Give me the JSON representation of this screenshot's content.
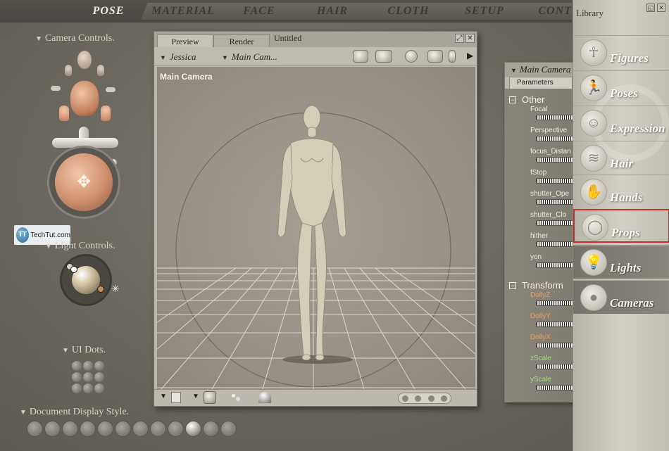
{
  "tabs": [
    "POSE",
    "MATERIAL",
    "FACE",
    "HAIR",
    "CLOTH",
    "SETUP",
    "CONTE"
  ],
  "active_tab": "POSE",
  "left_panel": {
    "camera_controls_label": "Camera Controls.",
    "light_controls_label": "Light Controls.",
    "ui_dots_label": "UI Dots.",
    "document_display_style_label": "Document Display Style.",
    "watermark": {
      "logo_text": "TT",
      "text": "TechTut.com"
    }
  },
  "document": {
    "tabs": [
      "Preview",
      "Render"
    ],
    "active_tab": "Preview",
    "title": "Untitled",
    "figure_select": "Jessica",
    "camera_select": "Main Cam...",
    "viewport_label": "Main Camera"
  },
  "parameters": {
    "header": "Main Camera",
    "tab": "Parameters",
    "groups": [
      {
        "name": "Other",
        "params": [
          "Focal",
          "Perspective",
          "focus_Distan",
          "fStop",
          "shutter_Ope",
          "shutter_Clo",
          "hither",
          "yon"
        ]
      },
      {
        "name": "Transform",
        "params": [
          "DollyZ",
          "DollyY",
          "DollyX",
          "zScale",
          "yScale"
        ]
      }
    ],
    "colors": {
      "default": "#f1ede3",
      "dolly": "#e8a25a",
      "scale": "#9fe07e"
    }
  },
  "library": {
    "title": "Library",
    "items": [
      {
        "label": "Figures",
        "icon": "figure-icon"
      },
      {
        "label": "Poses",
        "icon": "running-figure-icon"
      },
      {
        "label": "Expression",
        "icon": "face-icon"
      },
      {
        "label": "Hair",
        "icon": "hair-icon"
      },
      {
        "label": "Hands",
        "icon": "hand-icon"
      },
      {
        "label": "Props",
        "icon": "ring-icon"
      },
      {
        "label": "Lights",
        "icon": "bulb-icon"
      },
      {
        "label": "Cameras",
        "icon": "camera-icon"
      }
    ],
    "selected": "Props"
  }
}
